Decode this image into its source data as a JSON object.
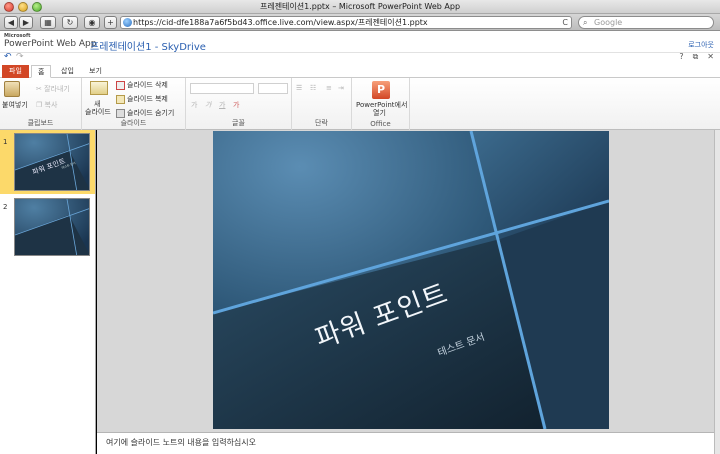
{
  "window": {
    "title": "프레젠테이션1.pptx – Microsoft PowerPoint Web App"
  },
  "browser": {
    "back": "◀",
    "forward": "▶",
    "plus": "+",
    "url": "https://cid-dfe188a7a6f5bd43.office.live.com/view.aspx/프레젠테이션1.pptx",
    "reload": "C",
    "search_placeholder": "Google"
  },
  "app": {
    "brand": "Microsoft",
    "name": "PowerPoint Web App",
    "doc_link": "프레젠테이션1 - SkyDrive",
    "sign_out": "로그아웃"
  },
  "quick_access": {
    "undo": "↶",
    "redo": "↷",
    "help": "?",
    "popout": "⧉",
    "close": "✕"
  },
  "tabs": [
    {
      "label": "파일"
    },
    {
      "label": "홈"
    },
    {
      "label": "삽입"
    },
    {
      "label": "보기"
    }
  ],
  "ribbon": {
    "clipboard": {
      "paste": "붙여넣기",
      "cut": "잘라내기",
      "copy": "복사",
      "label": "클립보드"
    },
    "slides": {
      "new_slide_line1": "새",
      "new_slide_line2": "슬라이드",
      "delete": "슬라이드 삭제",
      "duplicate": "슬라이드 복제",
      "hide": "슬라이드 숨기기",
      "label": "슬라이드"
    },
    "font": {
      "label": "글꼴",
      "bold": "가",
      "italic": "가",
      "underline": "가",
      "color": "가"
    },
    "paragraph": {
      "label": "단락"
    },
    "office": {
      "open_line1": "PowerPoint에서",
      "open_line2": "열기",
      "label": "Office"
    }
  },
  "thumbnails": [
    {
      "number": "1",
      "selected": true
    },
    {
      "number": "2",
      "selected": false
    }
  ],
  "slide": {
    "title": "파워 포인트",
    "subtitle": "테스트 문서"
  },
  "thumb_text": {
    "title": "파워 포인트",
    "subtitle": "테스트 문서"
  },
  "notes": {
    "placeholder": "여기에 슬라이드 노트의 내용을 입력하십시오"
  },
  "colors": {
    "file_tab": "#d24726",
    "link": "#2a5fb0",
    "selected_thumb": "#fcd96a"
  }
}
